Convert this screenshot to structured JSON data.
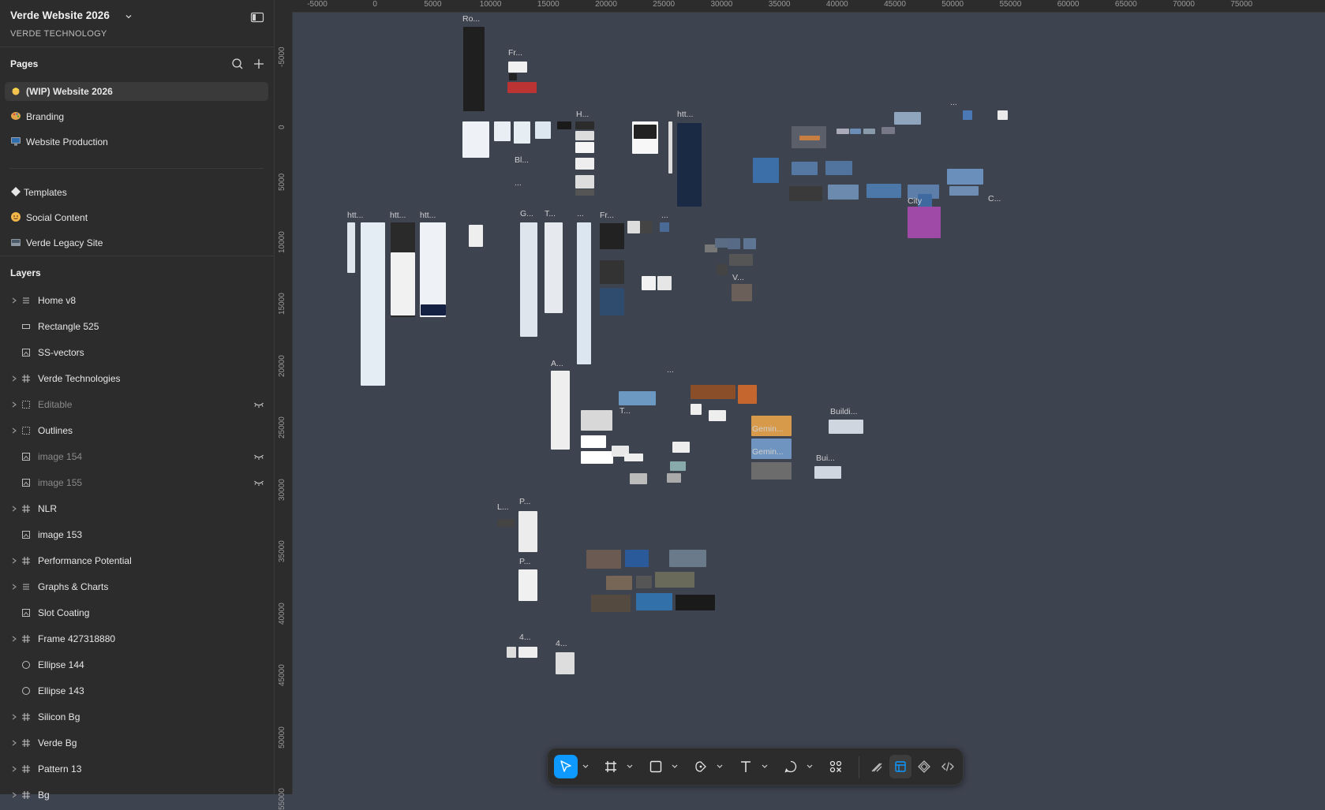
{
  "file": {
    "title": "Verde Website 2026",
    "org": "VERDE TECHNOLOGY"
  },
  "pages": {
    "title": "Pages",
    "items": [
      {
        "label": "(WIP) Website 2026",
        "icon": "construction-worker-icon",
        "active": true
      },
      {
        "label": "Branding",
        "icon": "palette-icon"
      },
      {
        "label": "Website Production",
        "icon": "desktop-computer-icon"
      },
      {
        "label": "Templates",
        "icon": "component-icon"
      },
      {
        "label": "Social Content",
        "icon": "smiley-icon"
      },
      {
        "label": "Verde Legacy Site",
        "icon": "archive-icon"
      }
    ]
  },
  "layers": {
    "title": "Layers",
    "items": [
      {
        "label": "Home v8",
        "type": "autolayout",
        "expandable": true
      },
      {
        "label": "Rectangle 525",
        "type": "rectangle"
      },
      {
        "label": "SS-vectors",
        "type": "image"
      },
      {
        "label": "Verde Technologies",
        "type": "frame",
        "expandable": true
      },
      {
        "label": "Editable",
        "type": "group",
        "expandable": true,
        "hidden": true
      },
      {
        "label": "Outlines",
        "type": "group",
        "expandable": true
      },
      {
        "label": "image 154",
        "type": "image",
        "hidden": true
      },
      {
        "label": "image 155",
        "type": "image",
        "hidden": true
      },
      {
        "label": "NLR",
        "type": "frame",
        "expandable": true
      },
      {
        "label": "image 153",
        "type": "image"
      },
      {
        "label": "Performance Potential",
        "type": "frame",
        "expandable": true
      },
      {
        "label": "Graphs & Charts",
        "type": "autolayout",
        "expandable": true
      },
      {
        "label": "Slot Coating",
        "type": "image"
      },
      {
        "label": "Frame 427318880",
        "type": "frame",
        "expandable": true
      },
      {
        "label": "Ellipse 144",
        "type": "ellipse"
      },
      {
        "label": "Ellipse 143",
        "type": "ellipse"
      },
      {
        "label": "Silicon Bg",
        "type": "frame",
        "expandable": true
      },
      {
        "label": "Verde Bg",
        "type": "frame",
        "expandable": true
      },
      {
        "label": "Pattern 13",
        "type": "frame",
        "expandable": true
      },
      {
        "label": "Bg",
        "type": "frame",
        "expandable": true
      }
    ]
  },
  "rulers": {
    "x_ticks": [
      "-5000",
      "0",
      "5000",
      "10000",
      "15000",
      "20000",
      "25000",
      "30000",
      "35000",
      "40000",
      "45000",
      "50000",
      "55000",
      "60000",
      "65000",
      "70000",
      "75000"
    ],
    "y_ticks": [
      "-5000",
      "0",
      "5000",
      "10000",
      "15000",
      "20000",
      "25000",
      "30000",
      "35000",
      "40000",
      "45000",
      "50000",
      "55000"
    ]
  },
  "canvas": {
    "labels": [
      "Ro...",
      "Fr...",
      "H...",
      "htt...",
      "Bl...",
      "...",
      "htt...",
      "htt...",
      "htt...",
      "G...",
      "T...",
      "...",
      "Fr...",
      "...",
      "V...",
      "C...",
      "City",
      "A...",
      "...",
      "T...",
      "Buildi...",
      "Bui...",
      "Gemin...",
      "Gemin...",
      "L...",
      "P...",
      "P...",
      "4...",
      "4...",
      "..."
    ]
  },
  "toolbar": {
    "tools": [
      {
        "name": "move-tool",
        "active": true
      },
      {
        "name": "frame-tool"
      },
      {
        "name": "rectangle-tool"
      },
      {
        "name": "pen-tool"
      },
      {
        "name": "text-tool"
      },
      {
        "name": "comment-tool"
      },
      {
        "name": "assets-tool"
      }
    ],
    "modes": [
      {
        "name": "draw-mode"
      },
      {
        "name": "design-mode",
        "active": true
      },
      {
        "name": "prototype-mode"
      },
      {
        "name": "dev-mode"
      }
    ]
  },
  "colors": {
    "canvas": "#3e4350",
    "panel": "#2c2c2c",
    "accent": "#0d99ff"
  }
}
